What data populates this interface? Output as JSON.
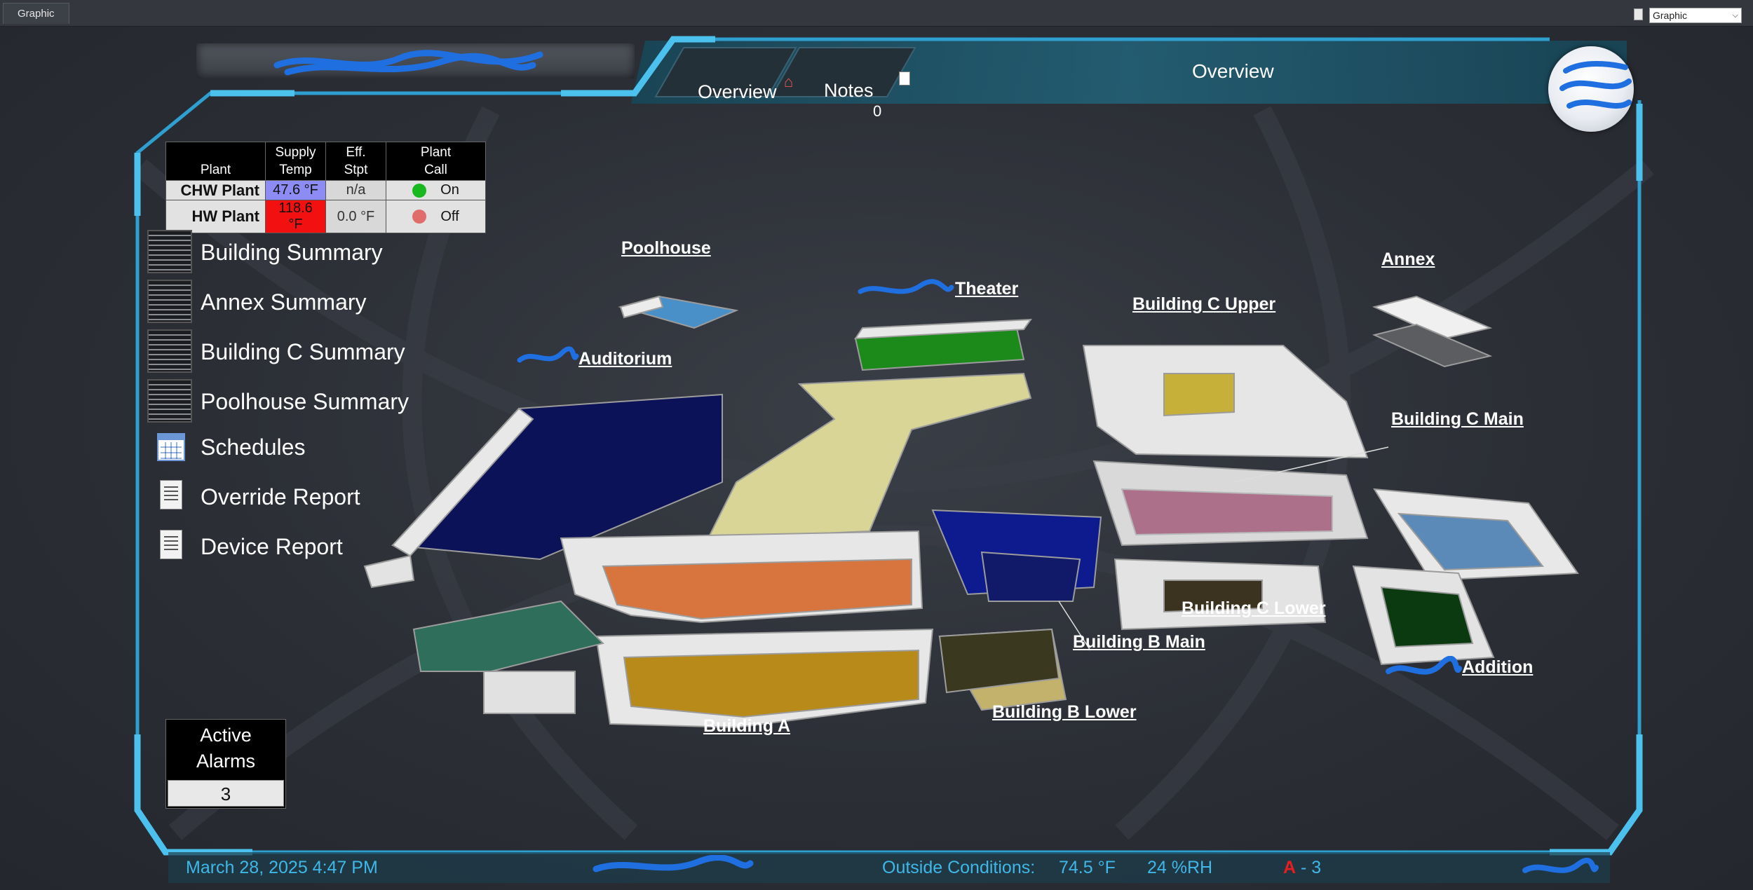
{
  "window": {
    "tab_label": "Graphic",
    "view_select": "Graphic"
  },
  "header": {
    "tabs": [
      {
        "label": "Overview",
        "icon": "house-icon"
      },
      {
        "label": "Notes",
        "count": "0",
        "icon": "document-icon"
      }
    ],
    "page_title": "Overview"
  },
  "plant_table": {
    "headers": [
      "Plant",
      "Supply\nTemp",
      "Eff.\nStpt",
      "Plant\nCall"
    ],
    "rows": [
      {
        "plant": "CHW Plant",
        "supply_temp": "47.6 °F",
        "eff_stpt": "n/a",
        "call": "On",
        "call_color": "#19b81f",
        "temp_color": "#8d8cf5"
      },
      {
        "plant": "HW Plant",
        "supply_temp": "118.6 °F",
        "eff_stpt": "0.0 °F",
        "call": "Off",
        "call_color": "#e06c6c",
        "temp_color": "#f21010"
      }
    ]
  },
  "nav": {
    "items": [
      {
        "label": "Building Summary",
        "icon": "floor-stack-icon"
      },
      {
        "label": "Annex Summary",
        "icon": "floor-stack-icon"
      },
      {
        "label": "Building C Summary",
        "icon": "floor-stack-icon"
      },
      {
        "label": "Poolhouse Summary",
        "icon": "floor-stack-icon"
      },
      {
        "label": "Schedules",
        "icon": "calendar-icon"
      },
      {
        "label": "Override Report",
        "icon": "report-icon"
      },
      {
        "label": "Device Report",
        "icon": "report-icon"
      }
    ]
  },
  "alarms": {
    "title_line1": "Active",
    "title_line2": "Alarms",
    "count": "3"
  },
  "map": {
    "labels": {
      "poolhouse": "Poolhouse",
      "theater": "Theater",
      "auditorium": "Auditorium",
      "building_c_upper": "Building C Upper",
      "annex": "Annex",
      "building_c_main": "Building C Main",
      "building_c_lower": "Building C Lower",
      "building_b_main": "Building B Main",
      "addition": "Addition",
      "building_b_lower": "Building B Lower",
      "building_a": "Building A"
    }
  },
  "footer": {
    "datetime": "March 28, 2025 4:47 PM",
    "outside_label": "Outside Conditions:",
    "outside_temp": "74.5 °F",
    "outside_rh": "24 %RH",
    "alarm_glyph": "A",
    "alarm_text": " - 3"
  },
  "colors": {
    "frame": "#2f9fd0",
    "footer_text": "#3fb7e8",
    "chw_temp": "#8d8cf5",
    "hw_temp": "#f21010"
  }
}
